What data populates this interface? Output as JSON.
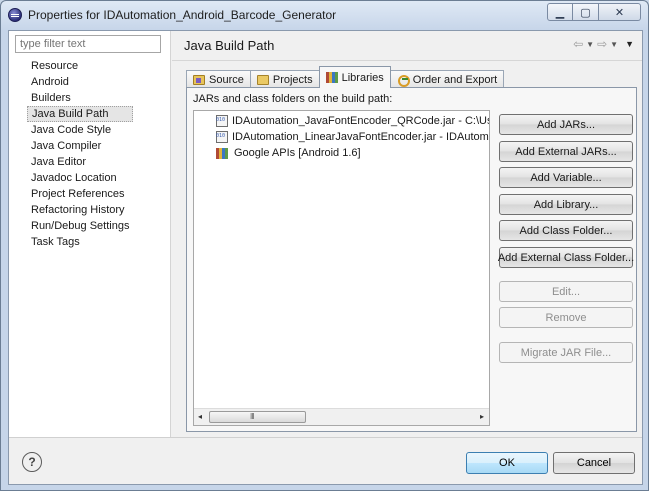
{
  "window": {
    "title": "Properties for IDAutomation_Android_Barcode_Generator",
    "minimize_glyph": "▁",
    "maximize_glyph": "▢",
    "close_glyph": "✕"
  },
  "sidebar": {
    "filter_placeholder": "type filter text",
    "items": [
      {
        "label": "Resource"
      },
      {
        "label": "Android"
      },
      {
        "label": "Builders"
      },
      {
        "label": "Java Build Path",
        "selected": true
      },
      {
        "label": "Java Code Style"
      },
      {
        "label": "Java Compiler"
      },
      {
        "label": "Java Editor"
      },
      {
        "label": "Javadoc Location"
      },
      {
        "label": "Project References"
      },
      {
        "label": "Refactoring History"
      },
      {
        "label": "Run/Debug Settings"
      },
      {
        "label": "Task Tags"
      }
    ]
  },
  "page": {
    "title": "Java Build Path",
    "nav": {
      "back": "⇦",
      "forward": "⇨",
      "dropdown": "▼",
      "menu": "▼"
    }
  },
  "tabs": [
    {
      "label": "Source",
      "icon": "source-folder-icon"
    },
    {
      "label": "Projects",
      "icon": "projects-folder-icon"
    },
    {
      "label": "Libraries",
      "icon": "libraries-icon",
      "active": true
    },
    {
      "label": "Order and Export",
      "icon": "order-export-icon"
    }
  ],
  "libraries": {
    "label": "JARs and class folders on the build path:",
    "entries": [
      {
        "text": "IDAutomation_JavaFontEncoder_QRCode.jar - C:\\Users\\",
        "icon": "jar-icon"
      },
      {
        "text": "IDAutomation_LinearJavaFontEncoder.jar - IDAutomatic",
        "icon": "jar-icon"
      },
      {
        "text": "Google APIs [Android 1.6]",
        "icon": "library-icon"
      }
    ],
    "scrollbar": {
      "left": "◂",
      "right": "▸",
      "grip": "III"
    }
  },
  "buttons": {
    "add_jars": "Add JARs...",
    "add_external_jars": "Add External JARs...",
    "add_variable": "Add Variable...",
    "add_library": "Add Library...",
    "add_class_folder": "Add Class Folder...",
    "add_external_class_folder": "Add External Class Folder...",
    "edit": "Edit...",
    "remove": "Remove",
    "migrate_jar": "Migrate JAR File..."
  },
  "footer": {
    "help": "?",
    "ok": "OK",
    "cancel": "Cancel"
  }
}
